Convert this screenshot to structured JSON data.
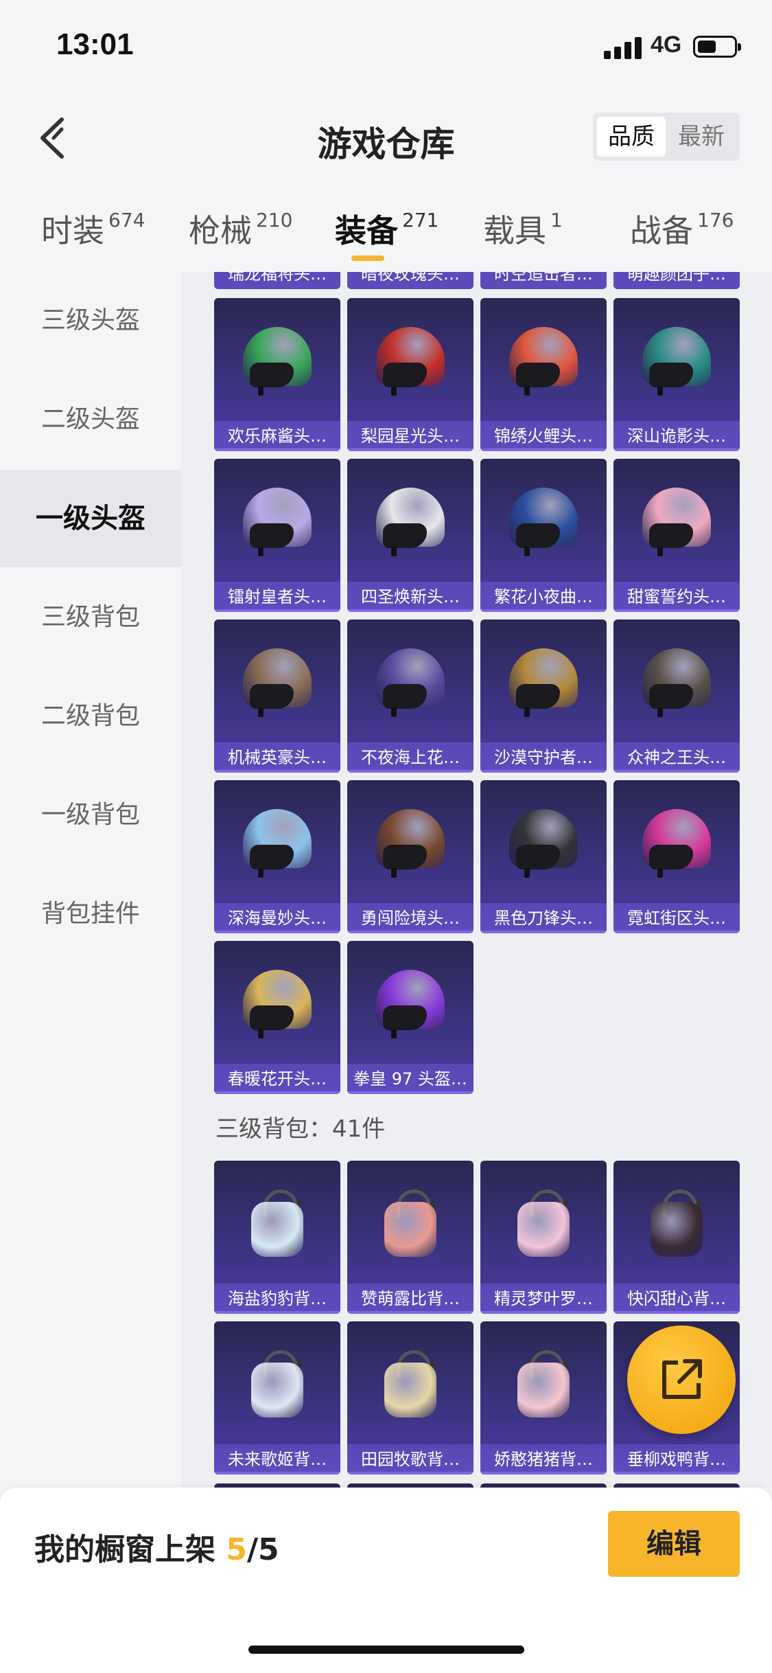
{
  "status": {
    "time": "13:01",
    "network": "4G"
  },
  "header": {
    "title": "游戏仓库",
    "sort": {
      "quality": "品质",
      "newest": "最新"
    }
  },
  "tabs": [
    {
      "label": "时装",
      "count": "674"
    },
    {
      "label": "枪械",
      "count": "210"
    },
    {
      "label": "装备",
      "count": "271"
    },
    {
      "label": "载具",
      "count": "1"
    },
    {
      "label": "战备",
      "count": "176"
    }
  ],
  "sidebar": [
    "三级头盔",
    "二级头盔",
    "一级头盔",
    "三级背包",
    "二级背包",
    "一级背包",
    "背包挂件"
  ],
  "top_partial_labels": [
    "瑞龙福将头…",
    "暗夜玫瑰头…",
    "时空追击者…",
    "萌趣颜团子…"
  ],
  "helmets": [
    {
      "name": "欢乐麻酱头…",
      "color": "#3aa65a"
    },
    {
      "name": "梨园星光头…",
      "color": "#c4302a"
    },
    {
      "name": "锦绣火鲤头…",
      "color": "#e2563a"
    },
    {
      "name": "深山诡影头…",
      "color": "#2a8c86"
    },
    {
      "name": "镭射皇者头…",
      "color": "#b9a8e6"
    },
    {
      "name": "四圣焕新头…",
      "color": "#e6e6ea"
    },
    {
      "name": "繁花小夜曲…",
      "color": "#2c4f9e"
    },
    {
      "name": "甜蜜誓约头…",
      "color": "#f0aac2"
    },
    {
      "name": "机械英豪头…",
      "color": "#8a6d55"
    },
    {
      "name": "不夜海上花…",
      "color": "#5a4aa0"
    },
    {
      "name": "沙漠守护者…",
      "color": "#b38a3a"
    },
    {
      "name": "众神之王头…",
      "color": "#5a5048"
    },
    {
      "name": "深海曼妙头…",
      "color": "#8ec2ea"
    },
    {
      "name": "勇闯险境头…",
      "color": "#7a4a30"
    },
    {
      "name": "黑色刀锋头…",
      "color": "#333438"
    },
    {
      "name": "霓虹街区头…",
      "color": "#d63a9a"
    },
    {
      "name": "春暖花开头…",
      "color": "#d9b65a"
    },
    {
      "name": "拳皇 97 头盔…",
      "color": "#8a3adb"
    }
  ],
  "section": {
    "title": "三级背包：41件"
  },
  "backpacks": [
    {
      "name": "海盐豹豹背…",
      "color": "#d6e8f4"
    },
    {
      "name": "赞萌露比背…",
      "color": "#e89a92"
    },
    {
      "name": "精灵梦叶罗…",
      "color": "#f2c4d8"
    },
    {
      "name": "快闪甜心背…",
      "color": "#3a2a34"
    },
    {
      "name": "未来歌姬背…",
      "color": "#dfe6f2"
    },
    {
      "name": "田园牧歌背…",
      "color": "#e6d7a8"
    },
    {
      "name": "娇憨猪猪背…",
      "color": "#f4c6cf"
    },
    {
      "name": "垂柳戏鸭背…",
      "color": "#4a4a52"
    }
  ],
  "bottom": {
    "shelf_label": "我的橱窗上架 ",
    "shelf_count": "5",
    "shelf_total": "/5",
    "edit": "编辑"
  }
}
